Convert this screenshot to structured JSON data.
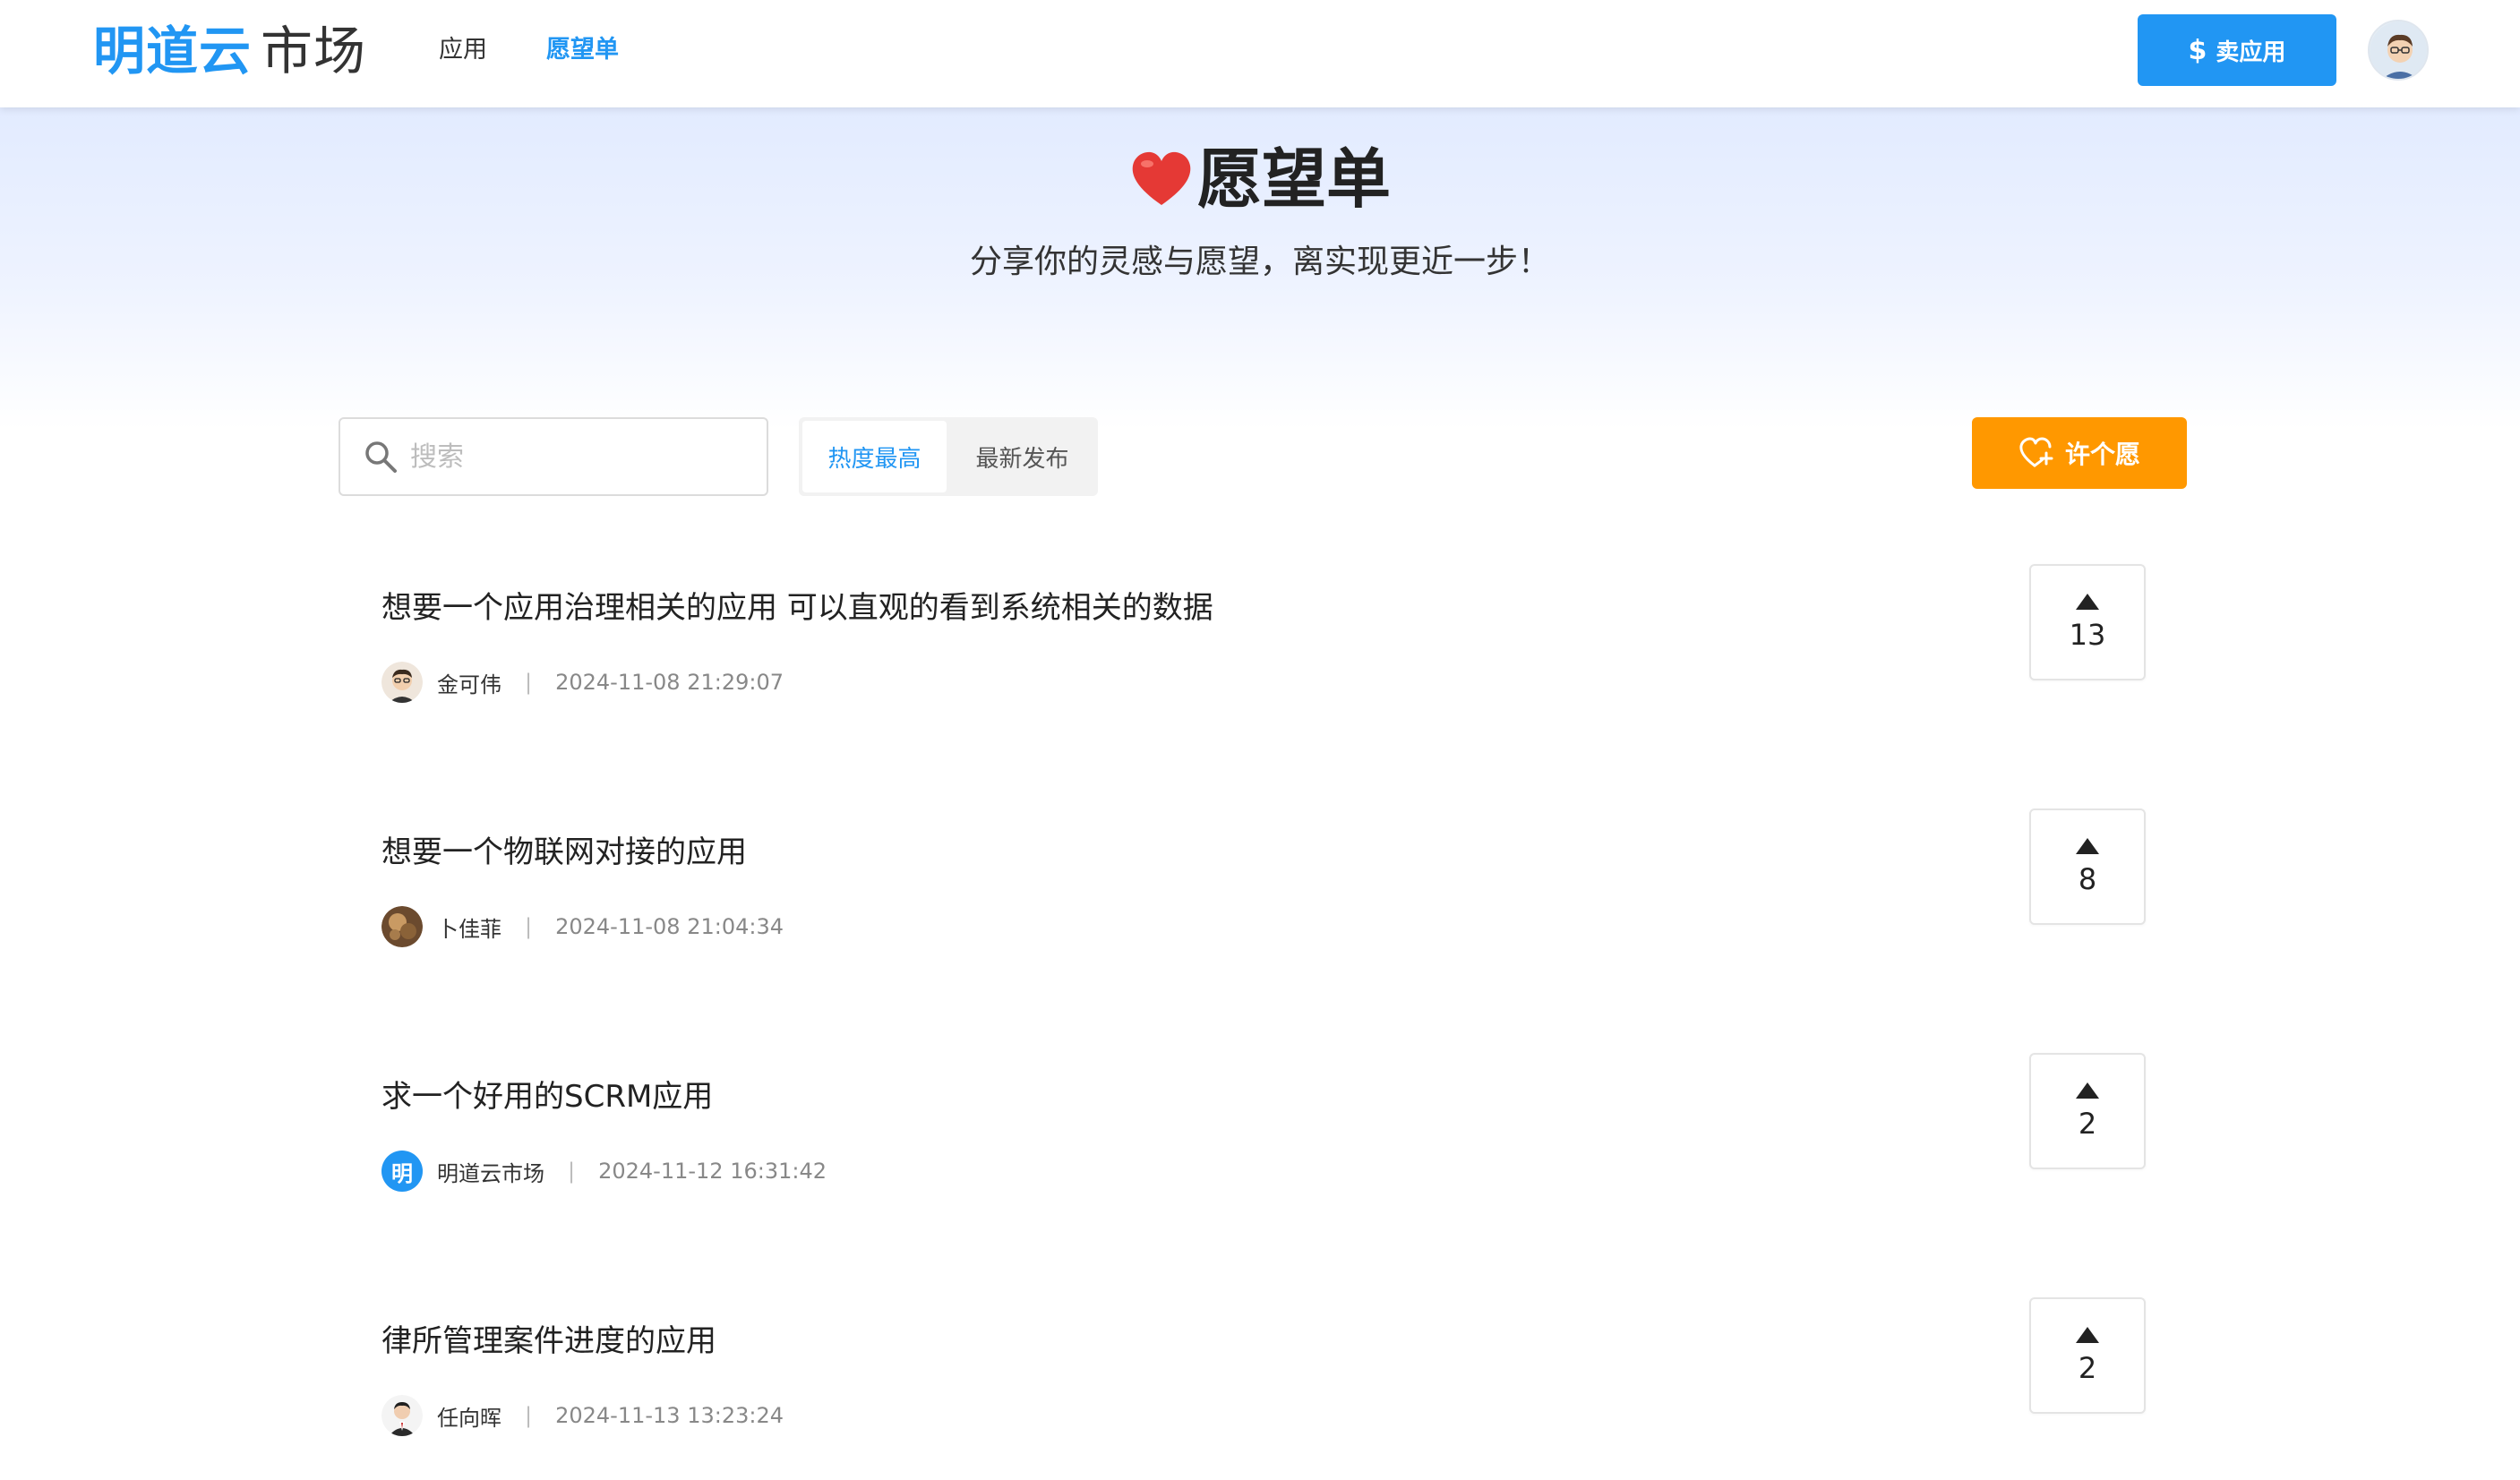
{
  "header": {
    "logo_brand": "明道云",
    "logo_market": "市场",
    "nav": [
      {
        "label": "应用",
        "active": false
      },
      {
        "label": "愿望单",
        "active": true
      }
    ],
    "sell_label": "卖应用"
  },
  "hero": {
    "title": "愿望单",
    "subtitle": "分享你的灵感与愿望，离实现更近一步！"
  },
  "toolbar": {
    "search_placeholder": "搜索",
    "sort_tabs": [
      {
        "label": "热度最高",
        "active": true
      },
      {
        "label": "最新发布",
        "active": false
      }
    ],
    "wish_label": "许个愿"
  },
  "wishes": [
    {
      "title": "想要一个应用治理相关的应用 可以直观的看到系统相关的数据",
      "author": "金可伟",
      "time": "2024-11-08 21:29:07",
      "votes": "13"
    },
    {
      "title": "想要一个物联网对接的应用",
      "author": "卜佳菲",
      "time": "2024-11-08 21:04:34",
      "votes": "8"
    },
    {
      "title": "求一个好用的SCRM应用",
      "author": "明道云市场",
      "author_badge": "明",
      "time": "2024-11-12 16:31:42",
      "votes": "2"
    },
    {
      "title": "律所管理案件进度的应用",
      "author": "任向晖",
      "time": "2024-11-13 13:23:24",
      "votes": "2"
    }
  ],
  "colors": {
    "primary": "#2196f3",
    "accent": "#ff9800",
    "heart": "#e53935"
  }
}
